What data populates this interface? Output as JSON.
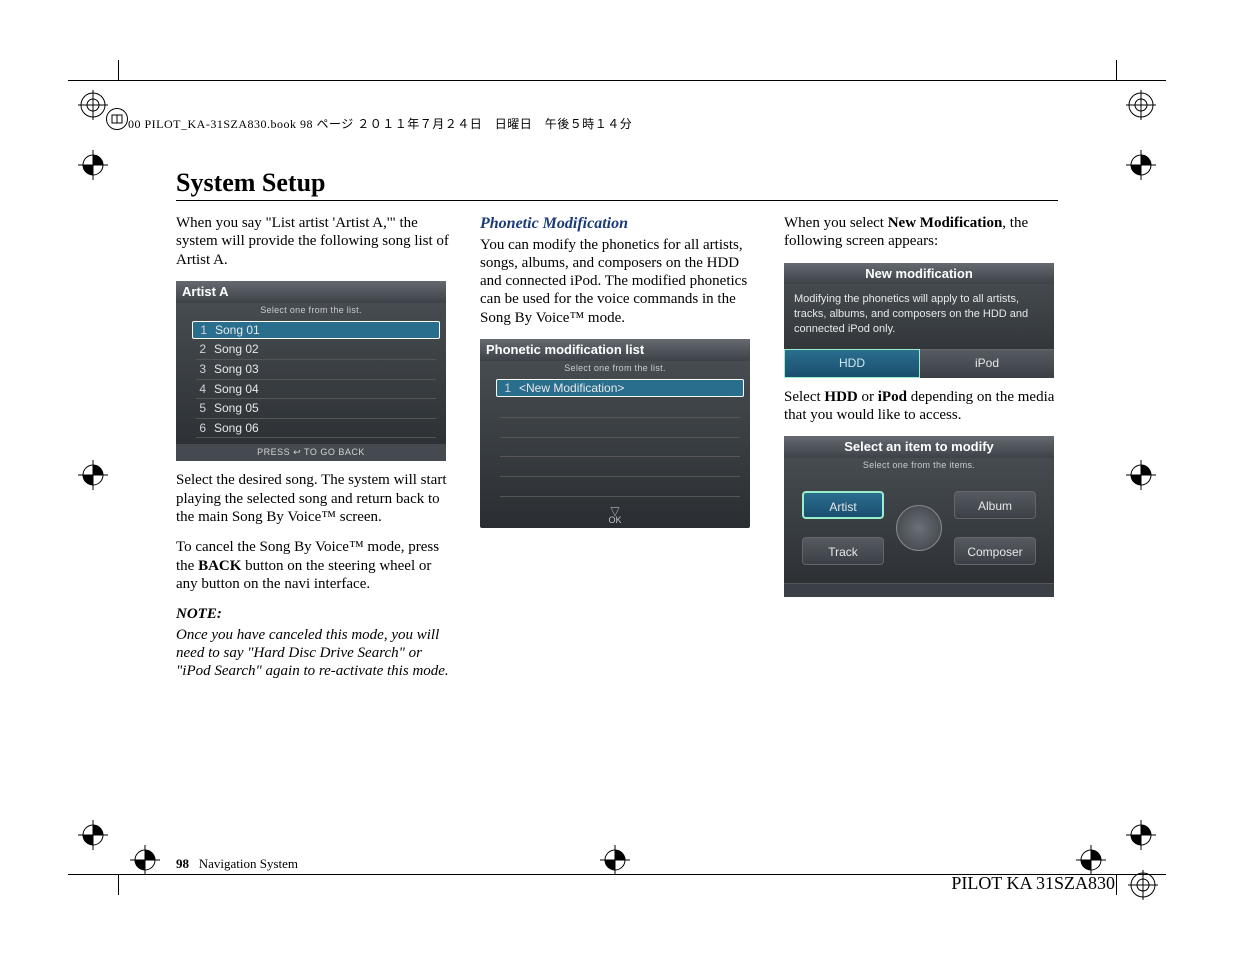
{
  "header_meta": "00 PILOT_KA-31SZA830.book  98 ページ  ２０１１年７月２４日　日曜日　午後５時１４分",
  "title": "System Setup",
  "col1": {
    "p1": "When you say \"List artist 'Artist A,'\" the system will provide the following song list of Artist A.",
    "screenshot": {
      "title": "Artist A",
      "subtitle": "Select one from the list.",
      "rows": [
        {
          "n": "1",
          "label": "Song 01",
          "selected": true
        },
        {
          "n": "2",
          "label": "Song 02"
        },
        {
          "n": "3",
          "label": "Song 03"
        },
        {
          "n": "4",
          "label": "Song 04"
        },
        {
          "n": "5",
          "label": "Song 05"
        },
        {
          "n": "6",
          "label": "Song 06"
        }
      ],
      "footer": "PRESS ↩ TO GO BACK"
    },
    "p2": "Select the desired song. The system will start playing the selected song and return back to the main Song By Voice™ screen.",
    "p3_a": "To cancel the Song By Voice™ mode, press the ",
    "p3_b": "BACK",
    "p3_c": " button on the steering wheel or any button on the navi interface.",
    "note_h": "NOTE:",
    "note_body": "Once you have canceled this mode, you will need to say \"Hard Disc Drive Search\" or \"iPod Search\" again to re-activate this mode."
  },
  "col2": {
    "h": "Phonetic Modification",
    "p1": "You can modify the phonetics for all artists, songs, albums, and composers on the HDD and connected iPod. The modified phonetics can be used for the voice commands in the Song By Voice™ mode.",
    "screenshot": {
      "title": "Phonetic modification list",
      "subtitle": "Select one from the list.",
      "row": {
        "n": "1",
        "label": "<New Modification>"
      },
      "ok": "OK"
    }
  },
  "col3": {
    "p1_a": "When you select ",
    "p1_b": "New Modification",
    "p1_c": ", the following screen appears:",
    "screenshot1": {
      "title": "New modification",
      "body": "Modifying the phonetics will apply to all artists, tracks, albums, and composers on the HDD and connected iPod only.",
      "btn1": "HDD",
      "btn2": "iPod"
    },
    "p2_a": "Select ",
    "p2_b": "HDD",
    "p2_c": " or ",
    "p2_d": "iPod",
    "p2_e": " depending on the media that you would like to access.",
    "screenshot2": {
      "title": "Select an item to modify",
      "subtitle": "Select one from the items.",
      "q": {
        "tl": "Artist",
        "tr": "Album",
        "bl": "Track",
        "br": "Composer"
      }
    }
  },
  "footer": {
    "page": "98",
    "section": "Navigation System",
    "doc": "PILOT KA  31SZA830"
  }
}
